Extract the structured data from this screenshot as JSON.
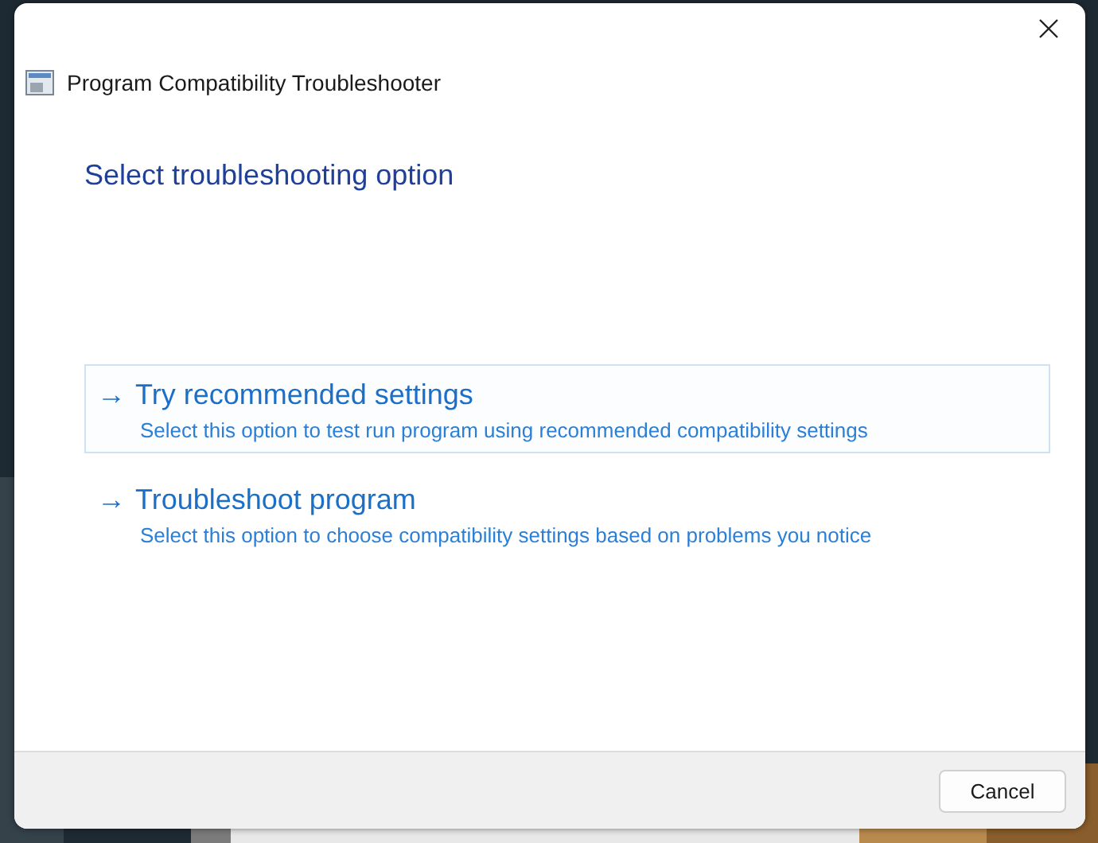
{
  "window": {
    "title": "Program Compatibility Troubleshooter"
  },
  "heading": "Select troubleshooting option",
  "options": [
    {
      "arrow": "→",
      "title": "Try recommended settings",
      "description": "Select this option to test run program using recommended compatibility settings",
      "highlighted": true
    },
    {
      "arrow": "→",
      "title": "Troubleshoot program",
      "description": "Select this option to choose compatibility settings based on problems you notice",
      "highlighted": false
    }
  ],
  "buttons": [
    "Cancel"
  ]
}
